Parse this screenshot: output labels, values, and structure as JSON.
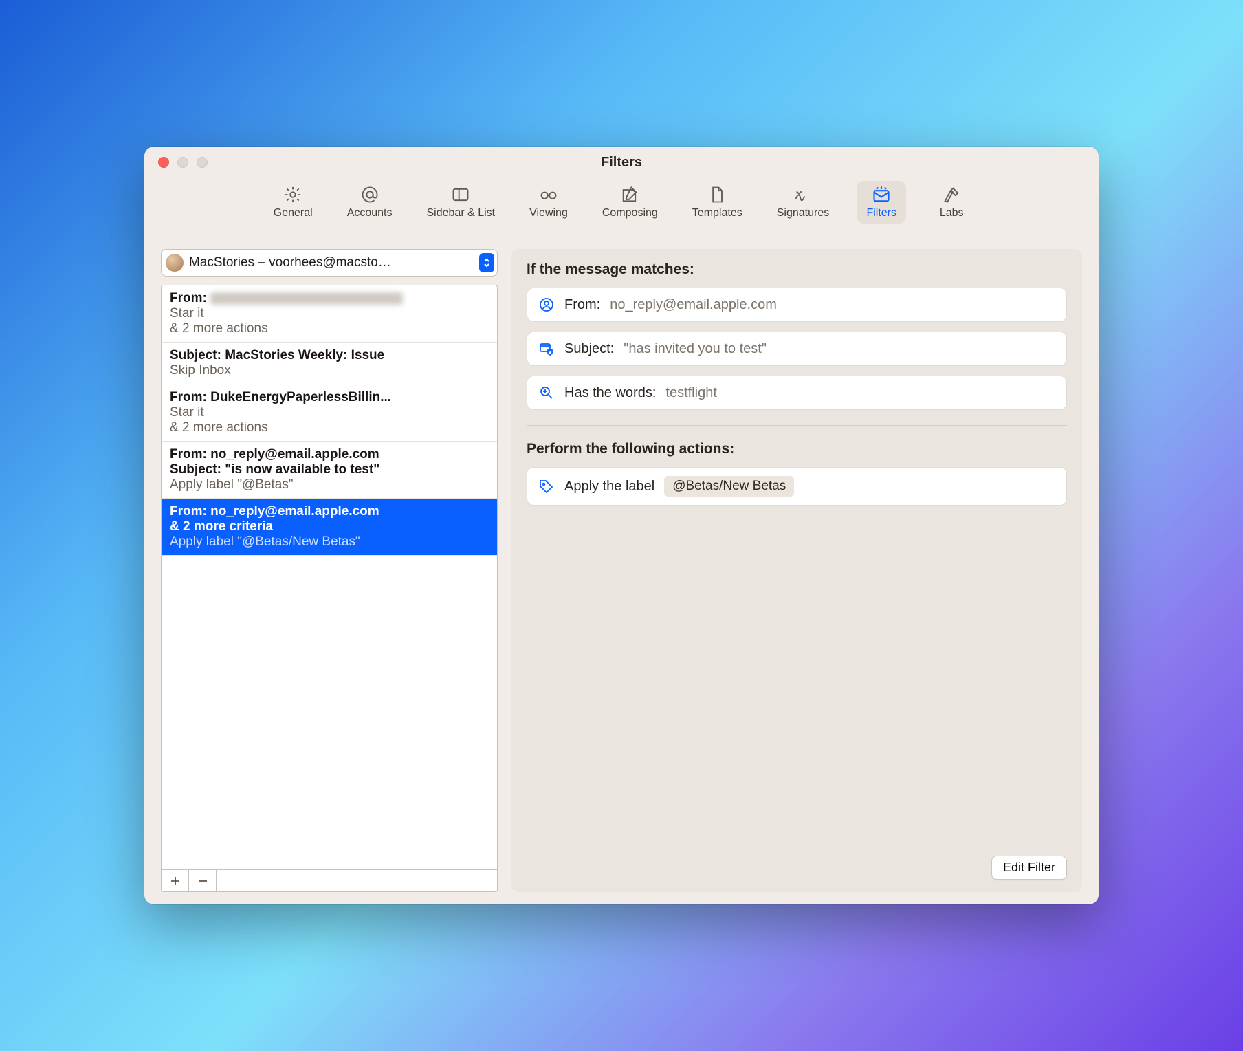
{
  "window": {
    "title": "Filters"
  },
  "toolbar": {
    "items": [
      {
        "label": "General"
      },
      {
        "label": "Accounts"
      },
      {
        "label": "Sidebar & List"
      },
      {
        "label": "Viewing"
      },
      {
        "label": "Composing"
      },
      {
        "label": "Templates"
      },
      {
        "label": "Signatures"
      },
      {
        "label": "Filters"
      },
      {
        "label": "Labs"
      }
    ]
  },
  "account": {
    "display": "MacStories – voorhees@macsto…"
  },
  "filters": [
    {
      "title": "From:",
      "title2": "",
      "sub1": "Star it",
      "sub2": "& 2 more actions",
      "redacted": true
    },
    {
      "title": "Subject: MacStories Weekly: Issue",
      "sub1": "Skip Inbox"
    },
    {
      "title": "From: DukeEnergyPaperlessBillin...",
      "sub1": "Star it",
      "sub2": "& 2 more actions"
    },
    {
      "title": "From: no_reply@email.apple.com",
      "title2": "Subject: \"is now available to test\"",
      "sub1": "Apply label \"@Betas\""
    },
    {
      "title": "From: no_reply@email.apple.com",
      "title2": "& 2 more criteria",
      "sub1": "Apply label \"@Betas/New Betas\"",
      "selected": true
    }
  ],
  "detail": {
    "matchHeading": "If the message matches:",
    "conditions": [
      {
        "icon": "person",
        "label": "From:",
        "value": "no_reply@email.apple.com"
      },
      {
        "icon": "subject",
        "label": "Subject:",
        "value": "\"has invited you to test\""
      },
      {
        "icon": "search",
        "label": "Has the words:",
        "value": "testflight"
      }
    ],
    "actionsHeading": "Perform the following actions:",
    "actions": [
      {
        "icon": "tag",
        "label": "Apply the label",
        "chip": "@Betas/New Betas"
      }
    ],
    "editButton": "Edit Filter"
  }
}
